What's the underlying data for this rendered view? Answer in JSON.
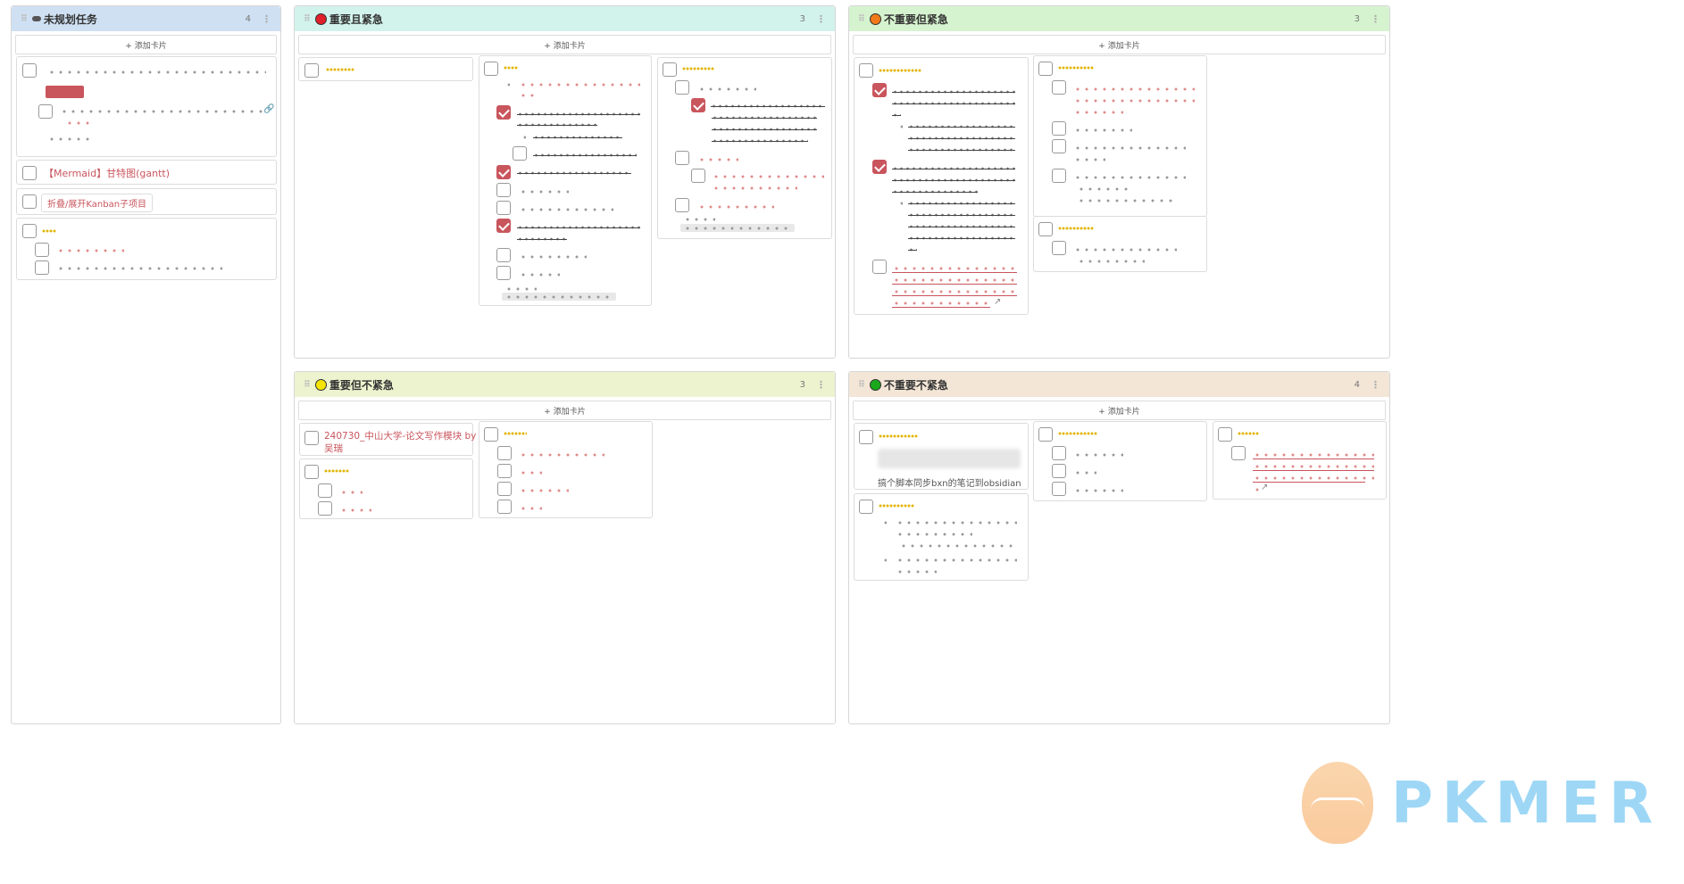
{
  "lanes": [
    {
      "title": "未规划任务",
      "count": "4",
      "header_color": "#cfe0f3",
      "dot": "#888888"
    },
    {
      "title": "重要且紧急",
      "count": "3",
      "header_color": "#d2f3ec",
      "dot": "#e0202a"
    },
    {
      "title": "不重要但紧急",
      "count": "3",
      "header_color": "#d6f3cf",
      "dot": "#f07a1a"
    },
    {
      "title": "重要但不紧急",
      "count": "3",
      "header_color": "#eef3cf",
      "dot": "#f4e400"
    },
    {
      "title": "不重要不紧急",
      "count": "4",
      "header_color": "#f3e6d6",
      "dot": "#1aa81a"
    }
  ],
  "add_card_label": "+ 添加卡片",
  "menu_glyph": "⋮",
  "grip_glyph": "⠿",
  "cards": {
    "mermaid_gantt": "【Mermaid】甘特图(gantt)",
    "kanban_fold": "折叠/展开Kanban子项目",
    "thesis_module_line1": "240730_中山大学-论文写作模块 by",
    "thesis_module_line2": "吴瑞",
    "bxn_sync": "搞个脚本同步bxn的笔记到obsidian"
  },
  "watermark": "PKMER",
  "icons": {
    "link": "link-icon",
    "external": "external-link-icon"
  }
}
